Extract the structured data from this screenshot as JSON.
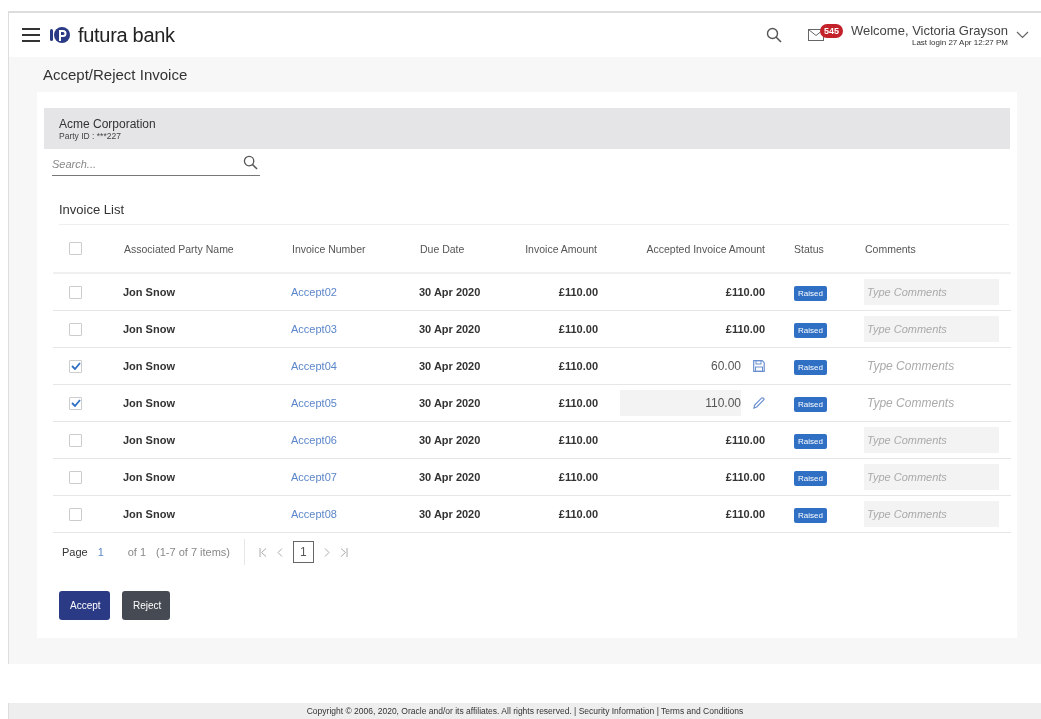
{
  "header": {
    "brand": "futura bank",
    "badge": "545",
    "welcome": "Welcome, Victoria Grayson",
    "last_login": "Last login 27 Apr 12:27 PM"
  },
  "page_title": "Accept/Reject Invoice",
  "party": {
    "name": "Acme Corporation",
    "party_id": "Party ID : ***227"
  },
  "search": {
    "placeholder": "Search..."
  },
  "section_title": "Invoice List",
  "table": {
    "select_all": {
      "checked": false
    },
    "columns": [
      "Associated Party Name",
      "Invoice Number",
      "Due Date",
      "Invoice Amount",
      "Accepted Invoice Amount",
      "Status",
      "Comments"
    ],
    "rows": [
      {
        "checked": false,
        "party": "Jon Snow",
        "invoice": "Accept02",
        "due": "30 Apr 2020",
        "amount": "£110.00",
        "accepted": "£110.00",
        "kind": "view",
        "status": "Raised",
        "comment_placeholder": "Type Comments"
      },
      {
        "checked": false,
        "party": "Jon Snow",
        "invoice": "Accept03",
        "due": "30 Apr 2020",
        "amount": "£110.00",
        "accepted": "£110.00",
        "kind": "view",
        "status": "Raised",
        "comment_placeholder": "Type Comments"
      },
      {
        "checked": true,
        "party": "Jon Snow",
        "invoice": "Accept04",
        "due": "30 Apr 2020",
        "amount": "£110.00",
        "accepted": "60.00",
        "kind": "save",
        "status": "Raised",
        "comment_placeholder": "Type Comments"
      },
      {
        "checked": true,
        "party": "Jon Snow",
        "invoice": "Accept05",
        "due": "30 Apr 2020",
        "amount": "£110.00",
        "accepted": "110.00",
        "kind": "edit",
        "status": "Raised",
        "comment_placeholder": "Type Comments"
      },
      {
        "checked": false,
        "party": "Jon Snow",
        "invoice": "Accept06",
        "due": "30 Apr 2020",
        "amount": "£110.00",
        "accepted": "£110.00",
        "kind": "view",
        "status": "Raised",
        "comment_placeholder": "Type Comments"
      },
      {
        "checked": false,
        "party": "Jon Snow",
        "invoice": "Accept07",
        "due": "30 Apr 2020",
        "amount": "£110.00",
        "accepted": "£110.00",
        "kind": "view",
        "status": "Raised",
        "comment_placeholder": "Type Comments"
      },
      {
        "checked": false,
        "party": "Jon Snow",
        "invoice": "Accept08",
        "due": "30 Apr 2020",
        "amount": "£110.00",
        "accepted": "£110.00",
        "kind": "view",
        "status": "Raised",
        "comment_placeholder": "Type Comments"
      }
    ]
  },
  "pagination": {
    "label": "Page",
    "page": "1",
    "of": "of 1",
    "summary": "(1-7 of 7 items)",
    "pages": [
      {
        "label": "1",
        "selected": true
      }
    ]
  },
  "buttons": [
    {
      "label": "Accept",
      "kind": "primary"
    },
    {
      "label": "Reject",
      "kind": "secondary"
    }
  ],
  "footer": {
    "copyright": "Copyright © 2006, 2020, Oracle and/or its affiliates. All rights reserved.",
    "separator": "|",
    "links": [
      "Security Information",
      "Terms and Conditions"
    ]
  }
}
